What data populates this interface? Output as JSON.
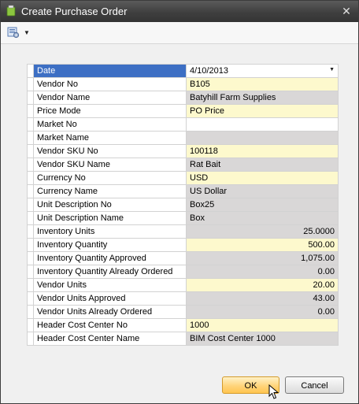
{
  "window": {
    "title": "Create Purchase Order",
    "close_label": "✕"
  },
  "toolbar": {
    "icon": "settings-dropdown-icon",
    "arrow": "▼"
  },
  "form": {
    "rows": [
      {
        "label": "Date",
        "value": "4/10/2013",
        "type": "dropdown",
        "selected": true
      },
      {
        "label": "Vendor No",
        "value": "B105",
        "type": "edit"
      },
      {
        "label": "Vendor Name",
        "value": "Batyhill Farm Supplies",
        "type": "ro"
      },
      {
        "label": "Price Mode",
        "value": "PO Price",
        "type": "edit"
      },
      {
        "label": "Market No",
        "value": "",
        "type": "white"
      },
      {
        "label": "Market Name",
        "value": "",
        "type": "ro"
      },
      {
        "label": "Vendor SKU No",
        "value": "100118",
        "type": "edit"
      },
      {
        "label": "Vendor SKU Name",
        "value": "Rat Bait",
        "type": "ro"
      },
      {
        "label": "Currency No",
        "value": "USD",
        "type": "edit"
      },
      {
        "label": "Currency Name",
        "value": "US Dollar",
        "type": "ro"
      },
      {
        "label": "Unit Description No",
        "value": "Box25",
        "type": "ro"
      },
      {
        "label": "Unit Description Name",
        "value": "Box",
        "type": "ro"
      },
      {
        "label": "Inventory Units",
        "value": "25.0000",
        "type": "ro",
        "num": true
      },
      {
        "label": "Inventory Quantity",
        "value": "500.00",
        "type": "edit",
        "num": true
      },
      {
        "label": "Inventory Quantity Approved",
        "value": "1,075.00",
        "type": "ro",
        "num": true
      },
      {
        "label": "Inventory Quantity Already Ordered",
        "value": "0.00",
        "type": "ro",
        "num": true
      },
      {
        "label": "Vendor Units",
        "value": "20.00",
        "type": "edit",
        "num": true
      },
      {
        "label": "Vendor Units Approved",
        "value": "43.00",
        "type": "ro",
        "num": true
      },
      {
        "label": "Vendor Units Already Ordered",
        "value": "0.00",
        "type": "ro",
        "num": true
      },
      {
        "label": "Header Cost Center No",
        "value": "1000",
        "type": "edit"
      },
      {
        "label": "Header Cost Center Name",
        "value": "BIM Cost Center 1000",
        "type": "ro"
      }
    ]
  },
  "buttons": {
    "ok_label": "OK",
    "cancel_label": "Cancel"
  }
}
